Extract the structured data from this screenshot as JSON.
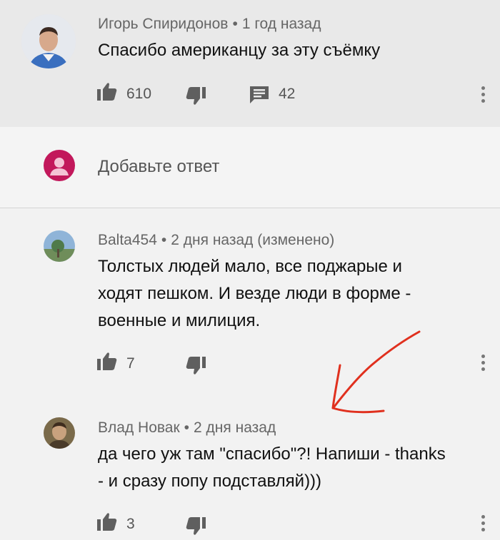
{
  "top_comment": {
    "author": "Игорь Спиридонов",
    "time": "1 год назад",
    "text": "Спасибо американцу за эту съёмку",
    "likes": "610",
    "replies_count": "42"
  },
  "reply_input": {
    "placeholder": "Добавьте ответ"
  },
  "replies": [
    {
      "author": "Balta454",
      "time": "2 дня назад (изменено)",
      "lines": [
        "Толстых людей мало, все поджарые и",
        "ходят пешком. И везде люди в форме -",
        "военные и милиция."
      ],
      "likes": "7"
    },
    {
      "author": "Влад Новак",
      "time": "2 дня назад",
      "lines": [
        "да чего уж там \"спасибо\"?! Напиши - thanks",
        "- и сразу попу подставляй)))"
      ],
      "likes": "3"
    }
  ],
  "colors": {
    "arrow": "#e0301e",
    "user_avatar": "#c2185b"
  },
  "icons": {
    "like": "thumb-up-icon",
    "dislike": "thumb-down-icon",
    "reply": "comment-icon",
    "more": "more-vert-icon"
  }
}
